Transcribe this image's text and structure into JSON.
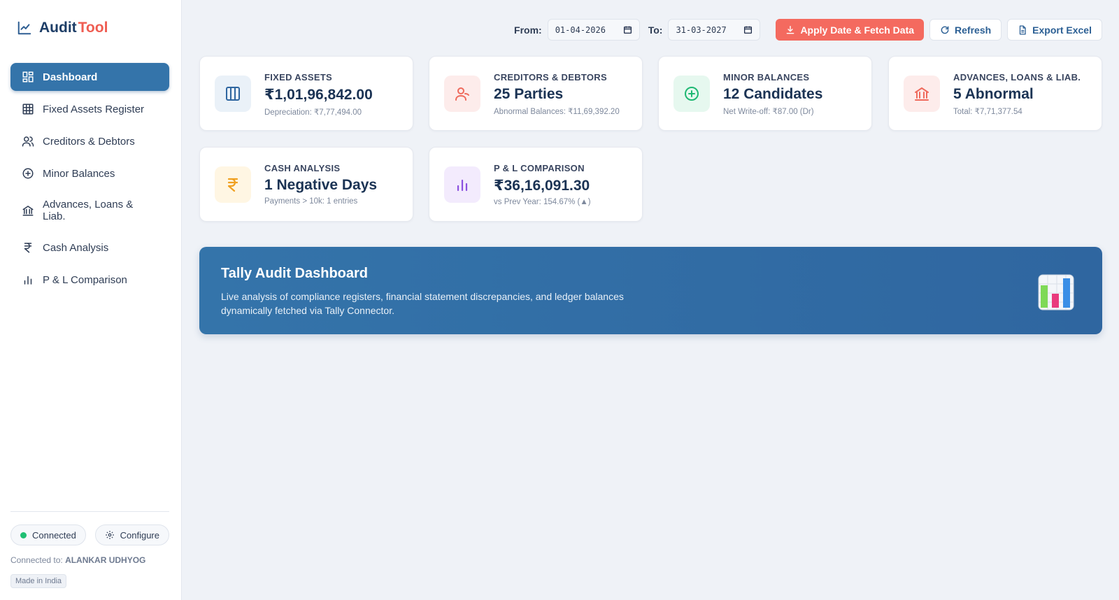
{
  "brand": {
    "name_part1": "Audit",
    "name_part2": "Tool"
  },
  "sidebar": {
    "items": [
      {
        "label": "Dashboard",
        "icon": "dashboard-icon",
        "active": true
      },
      {
        "label": "Fixed Assets Register",
        "icon": "grid-icon"
      },
      {
        "label": "Creditors & Debtors",
        "icon": "users-icon"
      },
      {
        "label": "Minor Balances",
        "icon": "plus-circle-icon"
      },
      {
        "label": "Advances, Loans & Liab.",
        "icon": "bank-icon"
      },
      {
        "label": "Cash Analysis",
        "icon": "rupee-icon"
      },
      {
        "label": "P & L Comparison",
        "icon": "bar-chart-icon"
      }
    ],
    "footer": {
      "status": "Connected",
      "configure": "Configure",
      "connected_to_label": "Connected to:",
      "company": "ALANKAR UDHYOG",
      "made_in": "Made in India"
    }
  },
  "header": {
    "from_label": "From:",
    "from_date": "01-04-2026",
    "to_label": "To:",
    "to_date": "31-03-2027",
    "apply_label": "Apply Date & Fetch Data",
    "refresh_label": "Refresh",
    "export_label": "Export Excel"
  },
  "cards": [
    {
      "title": "FIXED ASSETS",
      "value": "₹1,01,96,842.00",
      "sub": "Depreciation: ₹7,77,494.00",
      "icon": "columns-icon",
      "color": "#2f66a0",
      "bg": "#eaf1f8"
    },
    {
      "title": "CREDITORS & DEBTORS",
      "value": "25 Parties",
      "sub": "Abnormal Balances: ₹11,69,392.20",
      "icon": "user-icon",
      "color": "#ef6a5c",
      "bg": "#fdeceb"
    },
    {
      "title": "MINOR BALANCES",
      "value": "12 Candidates",
      "sub": "Net Write-off: ₹87.00 (Dr)",
      "icon": "plus-circle-icon",
      "color": "#1fb873",
      "bg": "#e6f8ef"
    },
    {
      "title": "ADVANCES, LOANS & LIAB.",
      "value": "5 Abnormal",
      "sub": "Total: ₹7,71,377.54",
      "icon": "bank-icon",
      "color": "#ef6a5c",
      "bg": "#fdeceb"
    },
    {
      "title": "CASH ANALYSIS",
      "value": "1 Negative Days",
      "sub": "Payments > 10k: 1 entries",
      "icon": "rupee-icon",
      "color": "#f0a020",
      "bg": "#fff6e3"
    },
    {
      "title": "P & L COMPARISON",
      "value": "₹36,16,091.30",
      "sub": "vs Prev Year: 154.67% (▲)",
      "icon": "bar-chart-icon",
      "color": "#8c52e0",
      "bg": "#f3ebfd"
    }
  ],
  "banner": {
    "title": "Tally Audit Dashboard",
    "description": "Live analysis of compliance registers, financial statement discrepancies, and ledger balances dynamically fetched via Tally Connector.",
    "icon": "chart-emoji-icon"
  }
}
